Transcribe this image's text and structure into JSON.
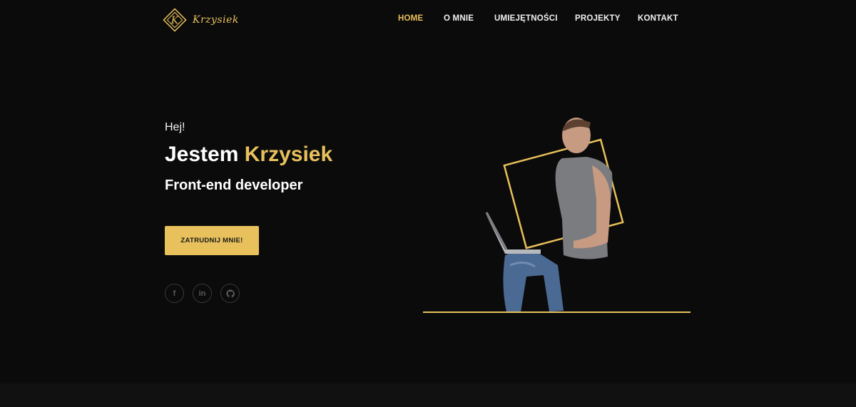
{
  "brand": {
    "logo_text": "Krzysiek",
    "logo_letter": "K",
    "accent": "#e8c15c"
  },
  "nav": {
    "items": [
      {
        "label": "HOME",
        "active": true
      },
      {
        "label": "O MNIE",
        "active": false
      },
      {
        "label": "UMIEJĘTNOŚCI",
        "active": false
      },
      {
        "label": "PROJEKTY",
        "active": false
      },
      {
        "label": "KONTAKT",
        "active": false
      }
    ]
  },
  "hero": {
    "greeting": "Hej!",
    "headline_prefix": "Jestem",
    "headline_name": "Krzysiek",
    "subtitle": "Front-end developer",
    "cta_label": "ZATRUDNIJ MNIE!"
  },
  "socials": [
    {
      "icon": "facebook-icon",
      "glyph": "f"
    },
    {
      "icon": "linkedin-icon",
      "glyph": "in"
    },
    {
      "icon": "github-icon",
      "glyph": ""
    }
  ]
}
